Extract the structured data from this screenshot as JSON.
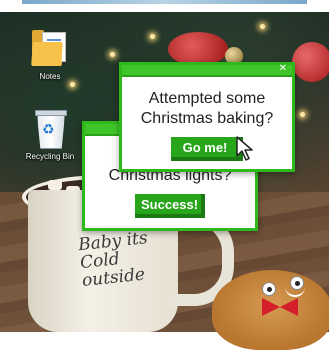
{
  "desktop": {
    "icons": [
      {
        "label": "Notes",
        "icon": "notes-folder-icon"
      },
      {
        "label": "Recycling Bin",
        "icon": "recycle-bin-icon"
      }
    ],
    "mug_text": "Baby its Cold outside"
  },
  "popups": {
    "back": {
      "question": "Christmas lights?",
      "button_label": "Success!"
    },
    "front": {
      "question": "Attempted some Christmas baking?",
      "button_label": "Go me!"
    },
    "close_glyph": "✕"
  },
  "colors": {
    "accent_green": "#2fb81b",
    "button_green": "#27a51b",
    "button_shadow": "#1b7a13"
  }
}
